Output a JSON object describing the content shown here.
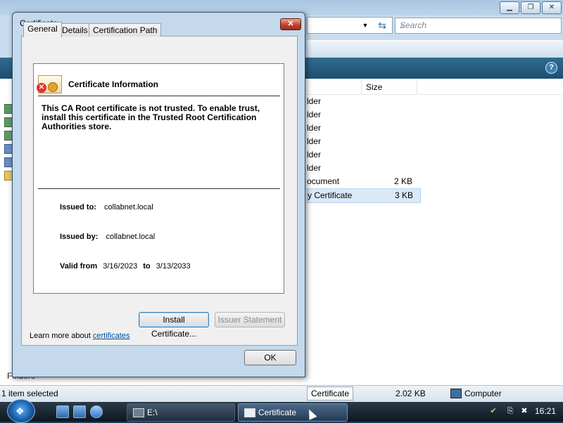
{
  "explorer": {
    "search_placeholder": "Search",
    "column_size": "Size",
    "files": [
      {
        "name": "lder",
        "size": ""
      },
      {
        "name": "lder",
        "size": ""
      },
      {
        "name": "lder",
        "size": ""
      },
      {
        "name": "lder",
        "size": ""
      },
      {
        "name": "lder",
        "size": ""
      },
      {
        "name": "lder",
        "size": ""
      },
      {
        "name": "ocument",
        "size": "2 KB"
      },
      {
        "name": "y Certificate",
        "size": "3 KB"
      }
    ],
    "folders_label": "Folders"
  },
  "statusbar": {
    "items_selected": "1 item selected",
    "type": "Certificate",
    "size": "2.02 KB",
    "location": "Computer"
  },
  "taskbar": {
    "tasks": [
      "E:\\",
      "Certificate"
    ],
    "clock": "16:21"
  },
  "dialog": {
    "title": "Certificate",
    "tabs": [
      "General",
      "Details",
      "Certification Path"
    ],
    "info_title": "Certificate Information",
    "trust_warning": "This CA Root certificate is not trusted. To enable trust, install this certificate in the Trusted Root Certification Authorities store.",
    "issued_to_label": "Issued to:",
    "issued_to": "collabnet.local",
    "issued_by_label": "Issued by:",
    "issued_by": "collabnet.local",
    "valid_from_label": "Valid from",
    "valid_from": "3/16/2023",
    "valid_to_label": "to",
    "valid_to": "3/13/2033",
    "install_button": "Install Certificate...",
    "issuer_button": "Issuer Statement",
    "learn_more_prefix": "Learn more about ",
    "learn_more_link": "certificates",
    "ok_button": "OK"
  }
}
